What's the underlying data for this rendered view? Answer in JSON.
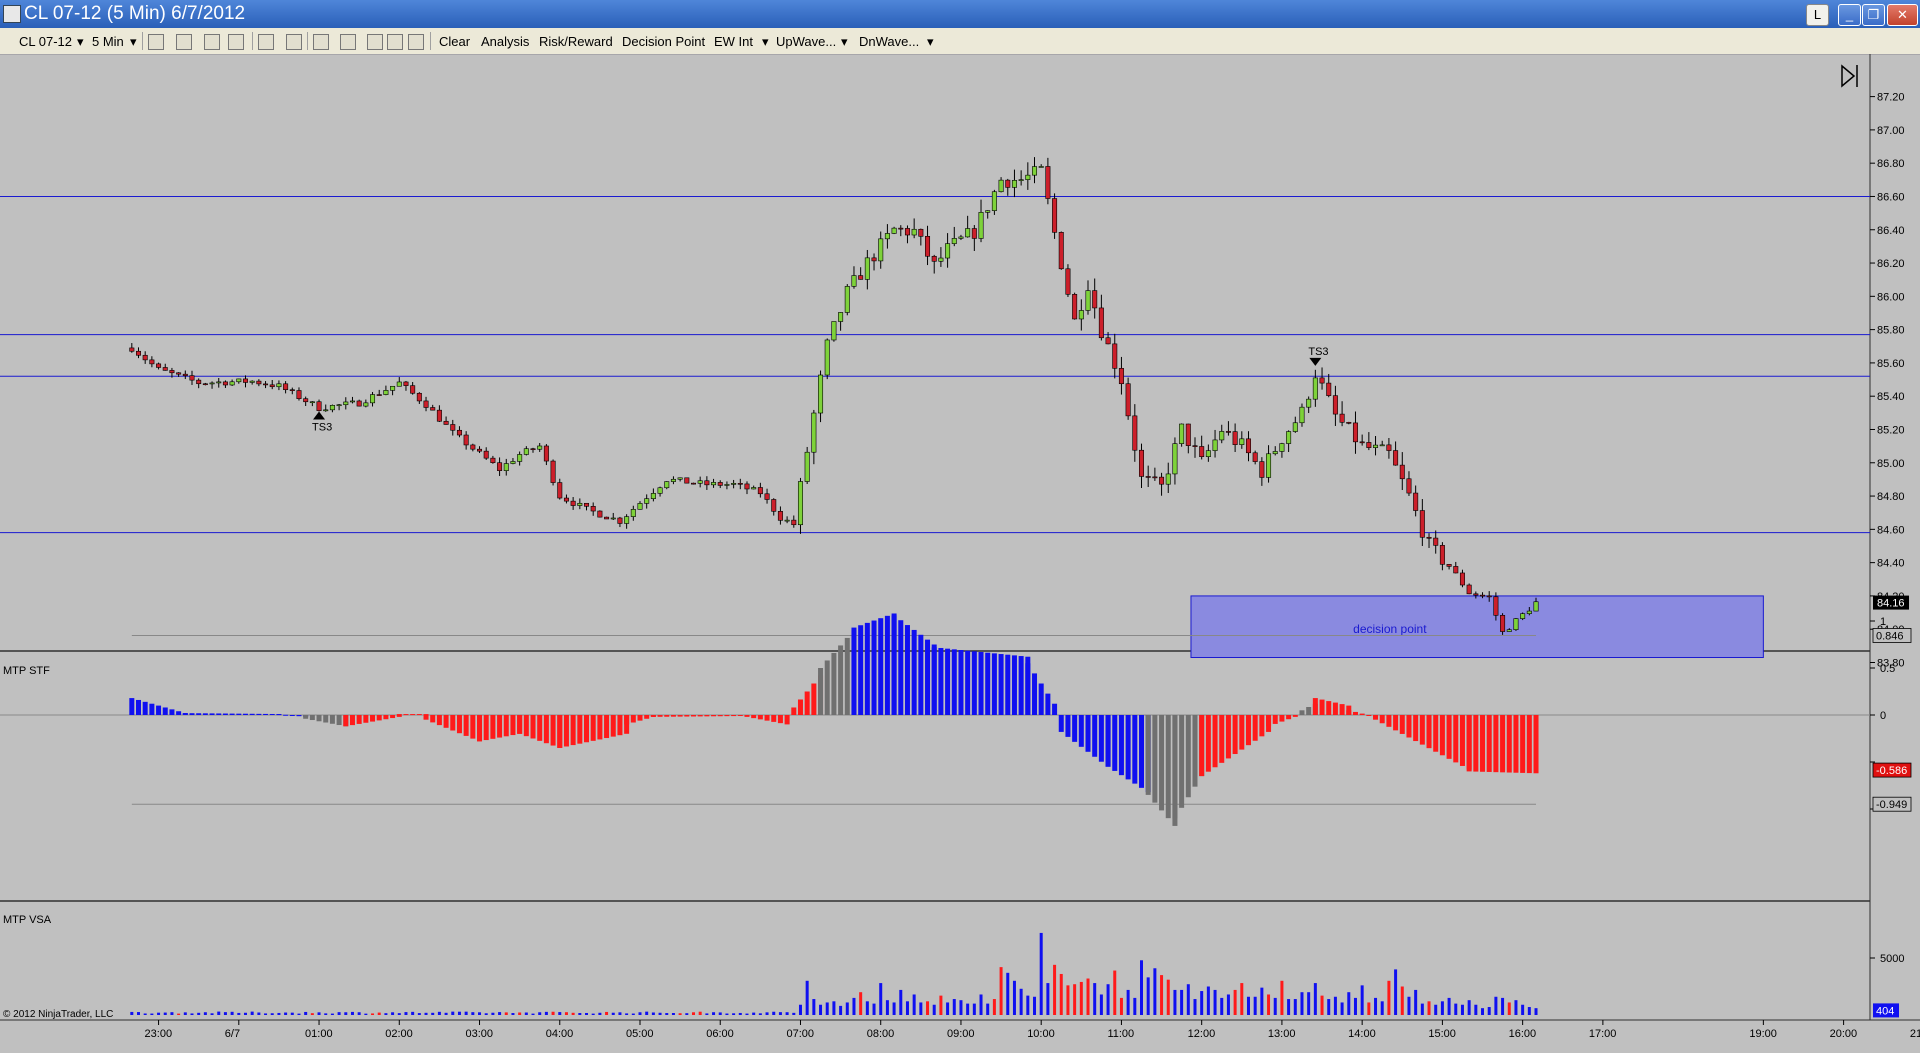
{
  "window": {
    "title": "CL 07-12 (5 Min)  6/7/2012",
    "buttons": [
      "L",
      "_",
      "❐",
      "✕"
    ]
  },
  "toolbar": {
    "instrument": "CL 07-12",
    "interval": "5 Min",
    "items": [
      "Clear",
      "Analysis",
      "Risk/Reward",
      "Decision Point",
      "EW Int",
      "UpWave...",
      "DnWave..."
    ]
  },
  "colors": {
    "background": "#c0c0c0",
    "up_candle": "#7ed23a",
    "down_candle": "#cc1f2a",
    "level_line": "#1a1ad0",
    "stf_blue": "#1010f0",
    "stf_red": "#ff1a1a",
    "stf_gray": "#707070",
    "zone_fill": "#8a8ae0"
  },
  "chart_data": [
    {
      "type": "candlestick",
      "title": "",
      "x_ticks": [
        "23:00",
        "6/7",
        "01:00",
        "02:00",
        "03:00",
        "04:00",
        "05:00",
        "06:00",
        "07:00",
        "08:00",
        "09:00",
        "10:00",
        "11:00",
        "12:00",
        "13:00",
        "14:00",
        "15:00",
        "16:00",
        "17:00",
        "19:00",
        "20:00",
        "21:00"
      ],
      "y_ticks": [
        "87.20",
        "87.00",
        "86.80",
        "86.60",
        "86.40",
        "86.20",
        "86.00",
        "85.80",
        "85.60",
        "85.40",
        "85.20",
        "85.00",
        "84.80",
        "84.60",
        "84.40",
        "84.20",
        "84.00",
        "83.80"
      ],
      "ylim": [
        83.72,
        87.25
      ],
      "last_price": "84.16",
      "horizontal_levels": [
        86.6,
        85.77,
        85.52,
        84.58
      ],
      "zone": {
        "label": "decision point",
        "from_time": "11:52",
        "to_time": "19:00",
        "low": 83.83,
        "high": 84.2
      },
      "markers": [
        {
          "label": "TS3",
          "time": "01:00",
          "price": 85.32,
          "direction": "up"
        },
        {
          "label": "TS3",
          "time": "13:25",
          "price": 85.57,
          "direction": "down"
        }
      ],
      "anchors": [
        [
          "22:40",
          85.69
        ],
        [
          "23:00",
          85.56
        ],
        [
          "23:30",
          85.48
        ],
        [
          "00:10",
          85.49
        ],
        [
          "00:30",
          85.46
        ],
        [
          "01:00",
          85.33
        ],
        [
          "01:30",
          85.36
        ],
        [
          "02:00",
          85.48
        ],
        [
          "02:20",
          85.35
        ],
        [
          "02:40",
          85.18
        ],
        [
          "03:15",
          84.96
        ],
        [
          "03:30",
          85.05
        ],
        [
          "03:45",
          85.1
        ],
        [
          "04:00",
          84.8
        ],
        [
          "04:20",
          84.72
        ],
        [
          "04:45",
          84.65
        ],
        [
          "05:00",
          84.76
        ],
        [
          "05:20",
          84.9
        ],
        [
          "05:50",
          84.87
        ],
        [
          "06:10",
          84.87
        ],
        [
          "06:30",
          84.82
        ],
        [
          "06:45",
          84.67
        ],
        [
          "06:55",
          84.63
        ],
        [
          "07:10",
          85.29
        ],
        [
          "07:20",
          85.7
        ],
        [
          "07:35",
          86.02
        ],
        [
          "07:50",
          86.2
        ],
        [
          "08:10",
          86.4
        ],
        [
          "08:25",
          86.39
        ],
        [
          "08:40",
          86.18
        ],
        [
          "08:50",
          86.28
        ],
        [
          "09:10",
          86.39
        ],
        [
          "09:30",
          86.7
        ],
        [
          "09:45",
          86.7
        ],
        [
          "10:00",
          86.75
        ],
        [
          "10:10",
          86.38
        ],
        [
          "10:25",
          85.85
        ],
        [
          "10:35",
          86.08
        ],
        [
          "10:45",
          85.8
        ],
        [
          "11:00",
          85.5
        ],
        [
          "11:15",
          84.9
        ],
        [
          "11:30",
          84.85
        ],
        [
          "11:45",
          85.2
        ],
        [
          "12:00",
          85.0
        ],
        [
          "12:15",
          85.2
        ],
        [
          "12:30",
          85.1
        ],
        [
          "12:45",
          84.95
        ],
        [
          "13:00",
          85.15
        ],
        [
          "13:15",
          85.3
        ],
        [
          "13:25",
          85.54
        ],
        [
          "13:40",
          85.28
        ],
        [
          "14:00",
          85.1
        ],
        [
          "14:20",
          85.05
        ],
        [
          "14:35",
          84.8
        ],
        [
          "14:50",
          84.5
        ],
        [
          "15:05",
          84.38
        ],
        [
          "15:20",
          84.22
        ],
        [
          "15:35",
          84.19
        ],
        [
          "15:45",
          83.98
        ],
        [
          "15:55",
          84.05
        ],
        [
          "16:10",
          84.16
        ]
      ]
    },
    {
      "type": "histogram",
      "title": "MTP STF",
      "y_ticks": [
        "1",
        "0.5",
        "0",
        "-0.5",
        "-1"
      ],
      "ylim": [
        -1.15,
        1.05
      ],
      "labels": {
        "upper": "0.846",
        "current": "-0.586",
        "lower": "-0.949"
      },
      "upper_band": 0.846,
      "lower_band": -0.949,
      "segments": [
        {
          "from": "22:40",
          "to": "23:20",
          "color": "blue",
          "start": 0.18,
          "end": 0.02
        },
        {
          "from": "23:20",
          "to": "00:30",
          "color": "blue",
          "start": 0.02,
          "end": 0.01
        },
        {
          "from": "00:30",
          "to": "00:50",
          "color": "blue",
          "start": 0.01,
          "end": -0.02
        },
        {
          "from": "00:50",
          "to": "01:20",
          "color": "gray",
          "start": -0.04,
          "end": -0.12
        },
        {
          "from": "01:20",
          "to": "02:00",
          "color": "red",
          "start": -0.12,
          "end": -0.02
        },
        {
          "from": "02:00",
          "to": "02:20",
          "color": "red",
          "start": 0.01,
          "end": 0.01
        },
        {
          "from": "02:20",
          "to": "03:00",
          "color": "red",
          "start": -0.05,
          "end": -0.28
        },
        {
          "from": "03:00",
          "to": "03:30",
          "color": "red",
          "start": -0.28,
          "end": -0.2
        },
        {
          "from": "03:30",
          "to": "04:00",
          "color": "red",
          "start": -0.2,
          "end": -0.35
        },
        {
          "from": "04:00",
          "to": "04:50",
          "color": "red",
          "start": -0.35,
          "end": -0.2
        },
        {
          "from": "04:50",
          "to": "05:10",
          "color": "red",
          "start": -0.1,
          "end": -0.02
        },
        {
          "from": "05:10",
          "to": "06:20",
          "color": "red",
          "start": -0.02,
          "end": -0.01
        },
        {
          "from": "06:20",
          "to": "06:50",
          "color": "red",
          "start": -0.02,
          "end": -0.1
        },
        {
          "from": "06:55",
          "to": "07:15",
          "color": "red",
          "start": 0.08,
          "end": 0.42
        },
        {
          "from": "07:15",
          "to": "07:40",
          "color": "gray",
          "start": 0.5,
          "end": 0.9
        },
        {
          "from": "07:40",
          "to": "08:10",
          "color": "blue",
          "start": 0.93,
          "end": 1.08
        },
        {
          "from": "08:10",
          "to": "08:40",
          "color": "blue",
          "start": 1.06,
          "end": 0.75
        },
        {
          "from": "08:40",
          "to": "09:50",
          "color": "blue",
          "start": 0.72,
          "end": 0.62
        },
        {
          "from": "09:50",
          "to": "10:10",
          "color": "blue",
          "start": 0.55,
          "end": 0.12
        },
        {
          "from": "10:15",
          "to": "10:50",
          "color": "blue",
          "start": -0.18,
          "end": -0.55
        },
        {
          "from": "10:50",
          "to": "11:20",
          "color": "blue",
          "start": -0.55,
          "end": -0.82
        },
        {
          "from": "11:20",
          "to": "11:40",
          "color": "gray",
          "start": -0.85,
          "end": -1.18
        },
        {
          "from": "11:40",
          "to": "12:00",
          "color": "gray",
          "start": -1.1,
          "end": -0.65
        },
        {
          "from": "12:00",
          "to": "12:50",
          "color": "red",
          "start": -0.65,
          "end": -0.18
        },
        {
          "from": "12:50",
          "to": "13:10",
          "color": "red",
          "start": -0.12,
          "end": -0.02
        },
        {
          "from": "13:15",
          "to": "13:25",
          "color": "gray",
          "start": 0.05,
          "end": 0.12
        },
        {
          "from": "13:25",
          "to": "13:50",
          "color": "red",
          "start": 0.18,
          "end": 0.1
        },
        {
          "from": "13:50",
          "to": "14:10",
          "color": "red",
          "start": 0.05,
          "end": -0.02
        },
        {
          "from": "14:10",
          "to": "15:20",
          "color": "red",
          "start": -0.05,
          "end": -0.58
        },
        {
          "from": "15:20",
          "to": "16:10",
          "color": "red",
          "start": -0.6,
          "end": -0.62
        }
      ]
    },
    {
      "type": "bar",
      "title": "MTP VSA",
      "y_ticks": [
        "5000"
      ],
      "ylim": [
        0,
        8000
      ],
      "last_value": "404",
      "baseline_end": "06:55",
      "baseline_tall": [
        [
          "07:00",
          900
        ],
        [
          "07:05",
          3000
        ],
        [
          "07:10",
          1400
        ],
        [
          "07:15",
          900
        ],
        [
          "07:20",
          1100
        ],
        [
          "07:25",
          1200
        ],
        [
          "07:30",
          800
        ],
        [
          "07:35",
          1100
        ],
        [
          "07:40",
          1500
        ],
        [
          "07:45",
          2000
        ],
        [
          "07:50",
          1200
        ],
        [
          "07:55",
          1000
        ],
        [
          "08:00",
          2800
        ],
        [
          "08:05",
          1300
        ],
        [
          "08:10",
          1100
        ],
        [
          "08:15",
          2200
        ],
        [
          "08:20",
          1200
        ],
        [
          "08:25",
          1800
        ],
        [
          "08:30",
          1100
        ],
        [
          "08:35",
          1200
        ],
        [
          "08:40",
          900
        ],
        [
          "08:45",
          1700
        ],
        [
          "08:50",
          1100
        ],
        [
          "08:55",
          1400
        ],
        [
          "09:00",
          1300
        ],
        [
          "09:05",
          1000
        ],
        [
          "09:10",
          1000
        ],
        [
          "09:15",
          1800
        ],
        [
          "09:20",
          1000
        ],
        [
          "09:25",
          1400
        ],
        [
          "09:30",
          4200
        ],
        [
          "09:35",
          3700
        ],
        [
          "09:40",
          3000
        ],
        [
          "09:45",
          2300
        ],
        [
          "09:50",
          1700
        ],
        [
          "09:55",
          1600
        ],
        [
          "10:00",
          7200
        ],
        [
          "10:05",
          2800
        ],
        [
          "10:10",
          4400
        ],
        [
          "10:15",
          3600
        ],
        [
          "10:20",
          2600
        ],
        [
          "10:25",
          2700
        ],
        [
          "10:30",
          2900
        ],
        [
          "10:35",
          3200
        ],
        [
          "10:40",
          2800
        ],
        [
          "10:45",
          1800
        ],
        [
          "10:50",
          2700
        ],
        [
          "10:55",
          3900
        ],
        [
          "11:00",
          1500
        ],
        [
          "11:05",
          2200
        ],
        [
          "11:10",
          1500
        ],
        [
          "11:15",
          4800
        ],
        [
          "11:20",
          3300
        ],
        [
          "11:25",
          4100
        ],
        [
          "11:30",
          3500
        ],
        [
          "11:35",
          3100
        ],
        [
          "11:40",
          2200
        ],
        [
          "11:45",
          2200
        ],
        [
          "11:50",
          2700
        ],
        [
          "11:55",
          1400
        ],
        [
          "12:00",
          2100
        ],
        [
          "12:05",
          2500
        ],
        [
          "12:10",
          2200
        ],
        [
          "12:15",
          1500
        ],
        [
          "12:20",
          1800
        ],
        [
          "12:25",
          2200
        ],
        [
          "12:30",
          2800
        ],
        [
          "12:35",
          1600
        ],
        [
          "12:40",
          1600
        ],
        [
          "12:45",
          2400
        ],
        [
          "12:50",
          1800
        ],
        [
          "12:55",
          1500
        ],
        [
          "13:00",
          3000
        ],
        [
          "13:05",
          1400
        ],
        [
          "13:10",
          1400
        ],
        [
          "13:15",
          2000
        ],
        [
          "13:20",
          2000
        ],
        [
          "13:25",
          2800
        ],
        [
          "13:30",
          1700
        ],
        [
          "13:35",
          1400
        ],
        [
          "13:40",
          1600
        ],
        [
          "13:45",
          1100
        ],
        [
          "13:50",
          2000
        ],
        [
          "13:55",
          1500
        ],
        [
          "14:00",
          2600
        ],
        [
          "14:05",
          1100
        ],
        [
          "14:10",
          1500
        ],
        [
          "14:15",
          1200
        ],
        [
          "14:20",
          3000
        ],
        [
          "14:25",
          4000
        ],
        [
          "14:30",
          2500
        ],
        [
          "14:35",
          1600
        ],
        [
          "14:40",
          2200
        ],
        [
          "14:45",
          1000
        ],
        [
          "14:50",
          1200
        ],
        [
          "14:55",
          900
        ],
        [
          "15:00",
          1200
        ],
        [
          "15:05",
          1500
        ],
        [
          "15:10",
          1000
        ],
        [
          "15:15",
          900
        ],
        [
          "15:20",
          1300
        ],
        [
          "15:25",
          900
        ],
        [
          "15:30",
          600
        ],
        [
          "15:35",
          700
        ],
        [
          "15:40",
          1600
        ],
        [
          "15:45",
          1500
        ],
        [
          "15:50",
          1100
        ],
        [
          "15:55",
          1300
        ],
        [
          "16:00",
          900
        ],
        [
          "16:05",
          700
        ],
        [
          "16:10",
          600
        ]
      ]
    }
  ],
  "footer": {
    "copyright": "© 2012 NinjaTrader, LLC"
  }
}
